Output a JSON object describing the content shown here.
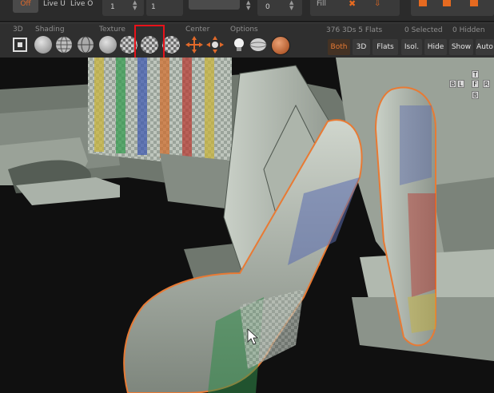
{
  "topbar": {
    "off_label": "Off",
    "live_u": "Live U",
    "live_o": "Live O",
    "value_1": "1",
    "value_2": "1",
    "value_3": "0",
    "fill_label": "Fill"
  },
  "toolbar": {
    "section_3d": "3D",
    "section_shading": "Shading",
    "section_texture": "Texture",
    "section_center": "Center",
    "section_options": "Options",
    "stat_objects": "376 3Ds 5 Flats",
    "stat_selected": "0 Selected",
    "stat_hidden": "0 Hidden",
    "btn_both": "Both",
    "btn_3d": "3D",
    "btn_flats": "Flats",
    "btn_isol": "Isol.",
    "btn_hide": "Hide",
    "btn_show": "Show",
    "btn_auto": "Auto"
  },
  "gizmo": {
    "top": "T",
    "back": "B",
    "left": "L",
    "front": "F",
    "right": "R",
    "bottom": "B"
  },
  "colors": {
    "accent": "#e0692a",
    "highlight": "#e8121a",
    "model_grey": "#b9c0b8",
    "edge_orange": "#e87a34"
  },
  "icons": [
    "frame-all-icon",
    "flat-sphere-icon",
    "wire-sphere-icon",
    "texture-sphere-icon",
    "checker-sphere-icon",
    "center-move-icon",
    "center-pivot-icon",
    "light-bulb-icon",
    "ellipsoid-icon",
    "orange-sphere-icon"
  ]
}
